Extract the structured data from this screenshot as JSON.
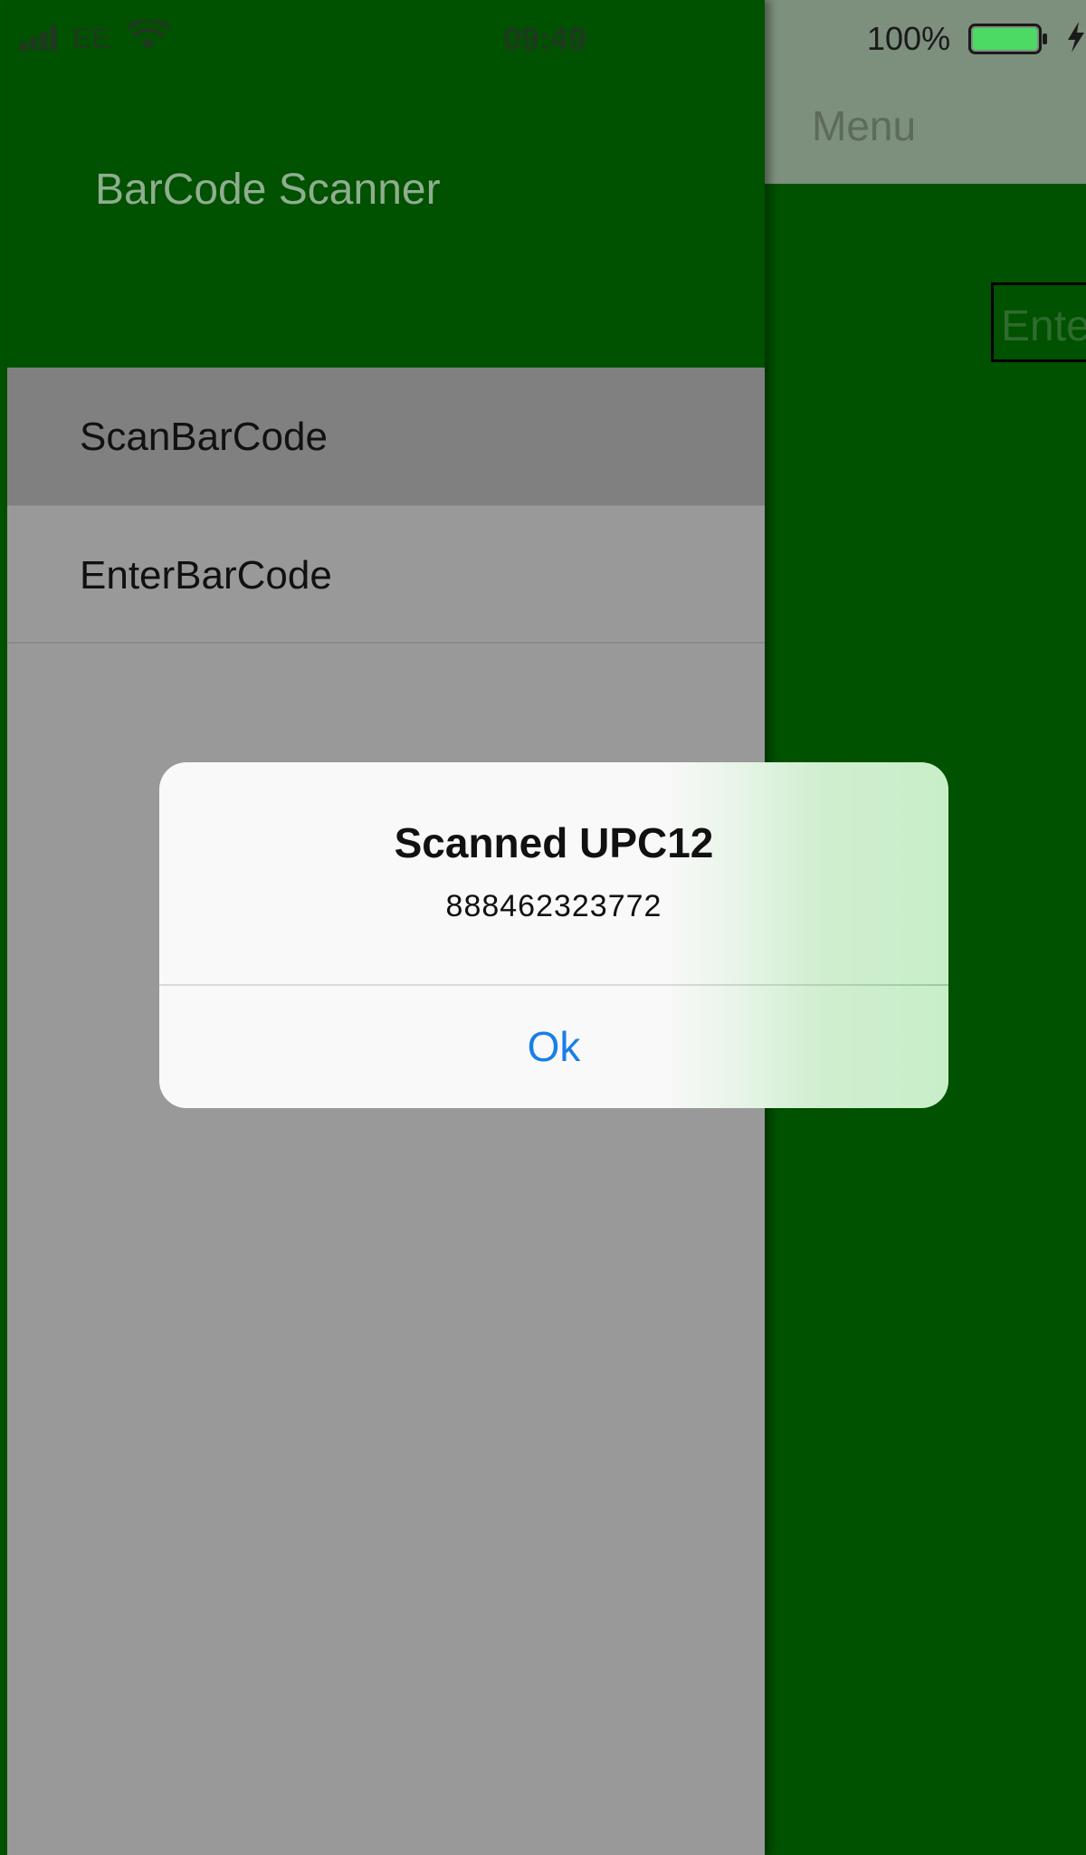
{
  "status_bar": {
    "carrier": "EE",
    "time": "09:49",
    "battery_percent": "100%",
    "battery_level": 1.0,
    "battery_color": "#4cd964"
  },
  "drawer": {
    "title": "BarCode Scanner",
    "items": [
      {
        "label": "ScanBarCode",
        "selected": true
      },
      {
        "label": "EnterBarCode",
        "selected": false
      }
    ]
  },
  "main_page": {
    "nav_title": "Menu",
    "entry_placeholder": "Enter"
  },
  "alert": {
    "title": "Scanned UPC12",
    "message": "888462323772",
    "ok_label": "Ok",
    "button_color": "#1a7ee8"
  },
  "colors": {
    "brand_green": "#005100",
    "drawer_gray": "#999999",
    "selected_gray": "#808080"
  }
}
